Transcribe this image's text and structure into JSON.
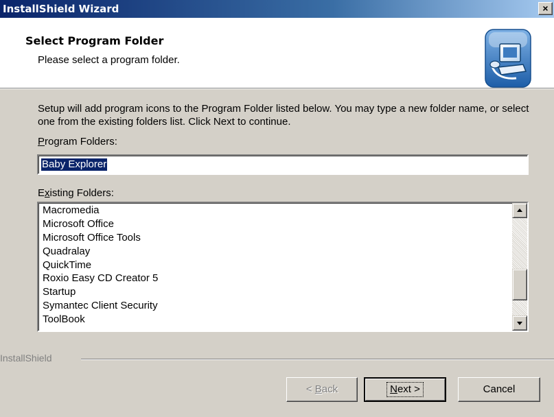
{
  "window": {
    "title": "InstallShield Wizard",
    "close_glyph": "×"
  },
  "header": {
    "title": "Select Program Folder",
    "subtitle": "Please select a program folder.",
    "logo_icon": "computer-setup-icon"
  },
  "body": {
    "intro": "Setup will add program icons to the Program Folder listed below.  You may type a new folder name, or select one from the existing folders list.  Click Next to continue.",
    "program_folders_label": {
      "mnemonic": "P",
      "rest": "rogram Folders:"
    },
    "program_folder_value": "Baby Explorer",
    "existing_folders_label": {
      "pre": "E",
      "mnemonic": "x",
      "rest": "isting Folders:"
    },
    "existing_folders": [
      "Macromedia",
      "Microsoft Office",
      "Microsoft Office Tools",
      "Quadralay",
      "QuickTime",
      "Roxio Easy CD Creator 5",
      "Startup",
      "Symantec Client Security",
      "ToolBook"
    ]
  },
  "footer": {
    "brand": "InstallShield",
    "back": {
      "pre": "< ",
      "mnemonic": "B",
      "rest": "ack"
    },
    "next": {
      "mnemonic": "N",
      "rest": "ext >"
    },
    "cancel": "Cancel"
  }
}
